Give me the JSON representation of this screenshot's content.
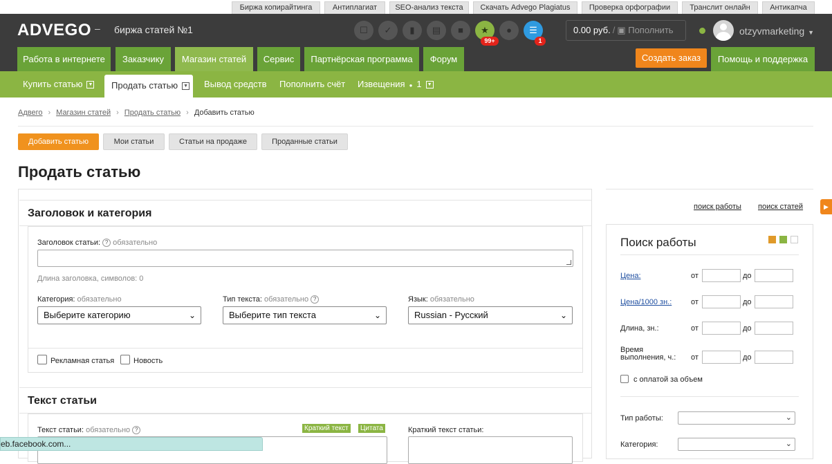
{
  "toplinks": [
    "Биржа копирайтинга",
    "Антиплагиат",
    "SEO-анализ текста",
    "Скачать Advego Plagiatus",
    "Проверка орфографии",
    "Транслит онлайн",
    "Антикапча"
  ],
  "header": {
    "logo": "ADVEGO",
    "dash": "–",
    "tagline": "биржа статей №1",
    "star_badge": "99+",
    "list_badge": "1",
    "balance": "0.00 руб.",
    "balance_sep": "/",
    "topup": "Пополнить",
    "username": "otzyvmarketing"
  },
  "mainnav": {
    "tabs": [
      "Работа в интернете",
      "Заказчику",
      "Магазин статей",
      "Сервис",
      "Партнёрская программа",
      "Форум"
    ],
    "create_order": "Создать заказ",
    "help": "Помощь и поддержка"
  },
  "subnav": {
    "buy": "Купить статью",
    "sell": "Продать статью",
    "withdraw": "Вывод средств",
    "topup": "Пополнить счёт",
    "notices": "Извещения",
    "notices_count": "1"
  },
  "breadcrumbs": [
    "Адвего",
    "Магазин статей",
    "Продать статью",
    "Добавить статью"
  ],
  "actions": [
    "Добавить статью",
    "Мои статьи",
    "Статьи на продаже",
    "Проданные статьи"
  ],
  "page_title": "Продать статью",
  "form": {
    "section1": "Заголовок и категория",
    "title_label": "Заголовок статьи:",
    "required": "обязательно",
    "title_length": "Длина заголовка, символов: 0",
    "category_label": "Категория:",
    "category_value": "Выберите категорию",
    "type_label": "Тип текста:",
    "type_value": "Выберите тип текста",
    "lang_label": "Язык:",
    "lang_value": "Russian - Русский",
    "ad_label": "Рекламная статья",
    "news_label": "Новость",
    "section2": "Текст статьи",
    "text_label": "Текст статьи:",
    "tag_short": "Краткий текст",
    "tag_quote": "Цитата",
    "short_label": "Краткий текст статьи:"
  },
  "search_links": [
    "поиск работы",
    "поиск статей"
  ],
  "search": {
    "title": "Поиск работы",
    "price": "Цена:",
    "price1000": "Цена/1000 зн.:",
    "length": "Длина, зн.:",
    "time_line1": "Время",
    "time_line2": "выполнения, ч.:",
    "from": "от",
    "to": "до",
    "volume": "с оплатой за объем",
    "work_type": "Тип работы:",
    "category": "Категория:",
    "colors": [
      "#e09a2a",
      "#8bb543",
      "#ffffff"
    ]
  },
  "status_url": "eb.facebook.com..."
}
